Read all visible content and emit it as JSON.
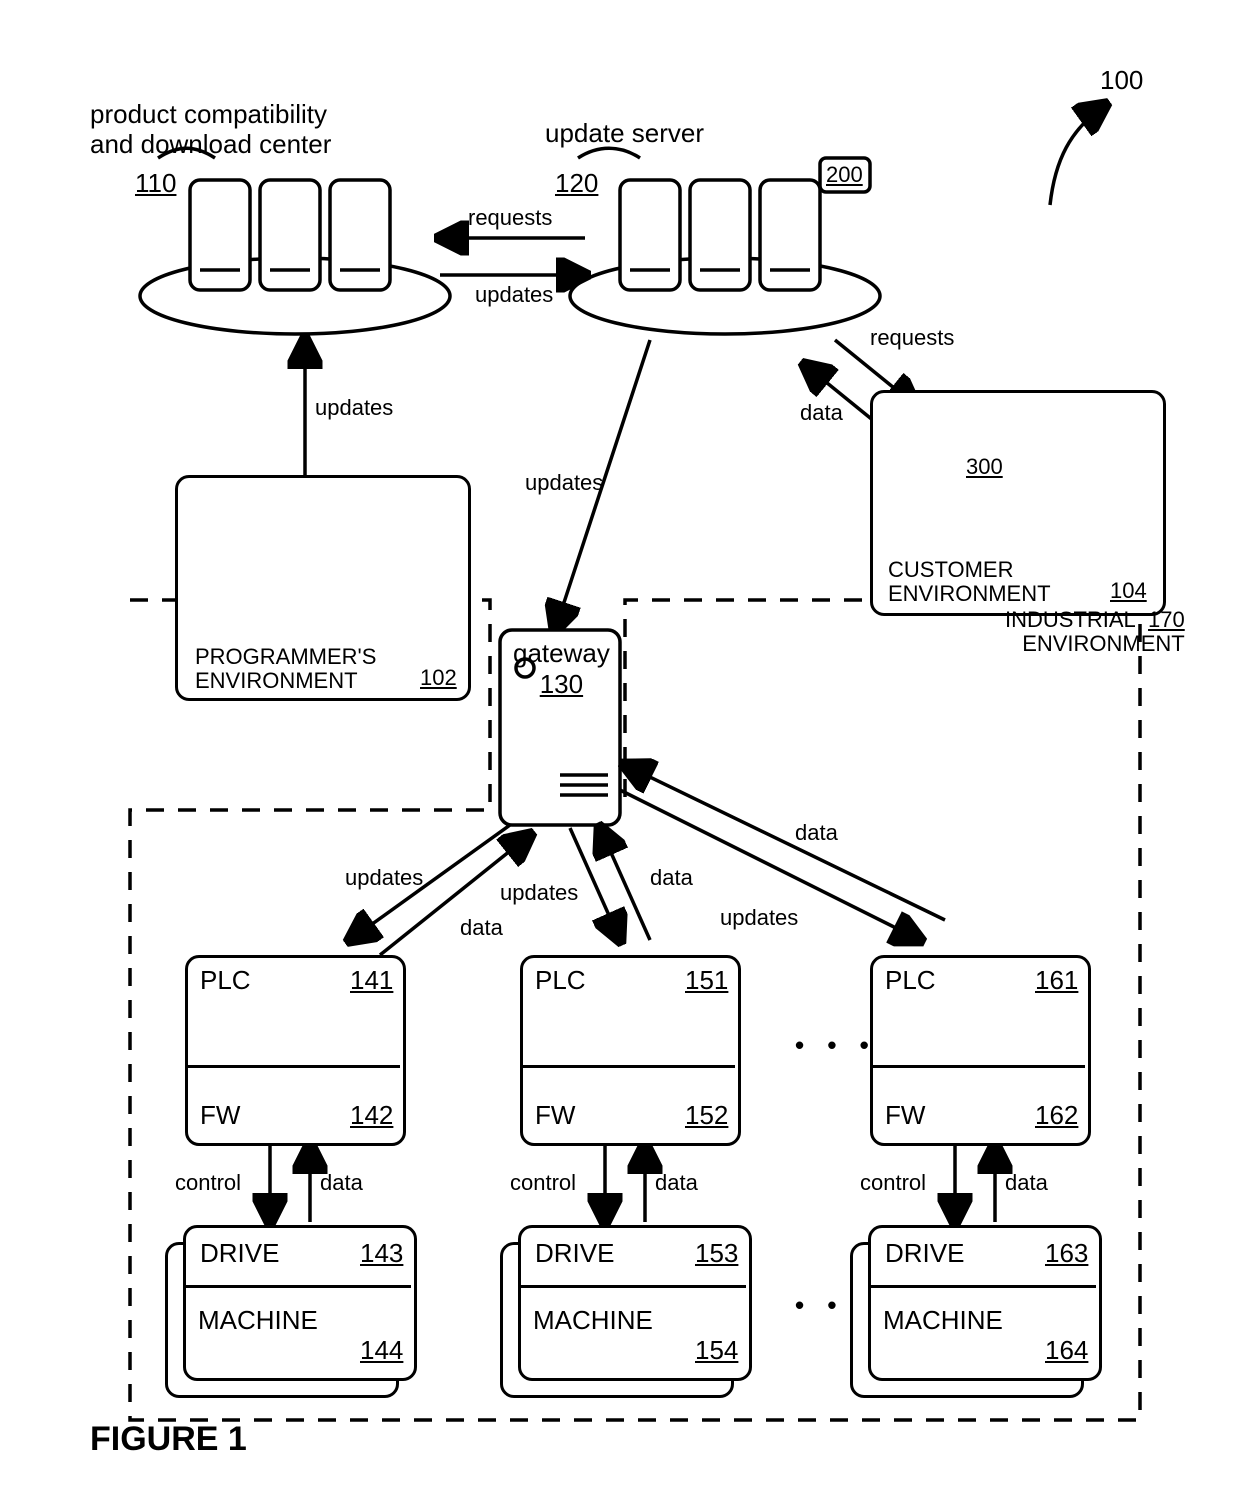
{
  "figure_label": "FIGURE 1",
  "system_ref": "100",
  "pcdc": {
    "label_line1": "product compatibility",
    "label_line2": "and download center",
    "ref": "110"
  },
  "update_server": {
    "label": "update server",
    "ref": "120"
  },
  "update_server_module": "200",
  "gateway": {
    "label": "gateway",
    "ref": "130"
  },
  "programmer_env": {
    "label_line1": "PROGRAMMER'S",
    "label_line2": "ENVIRONMENT",
    "ref": "102"
  },
  "customer_env": {
    "label_line1": "CUSTOMER",
    "label_line2": "ENVIRONMENT",
    "ref": "104",
    "module": "300"
  },
  "industrial_env": {
    "label_line1": "INDUSTRIAL",
    "label_line2": "ENVIRONMENT",
    "ref": "170"
  },
  "edge_labels": {
    "requests": "requests",
    "updates": "updates",
    "data": "data",
    "control": "control"
  },
  "ellipsis": "• • •",
  "plc_label": "PLC",
  "fw_label": "FW",
  "drive_label": "DRIVE",
  "machine_label": "MACHINE",
  "plc1": {
    "plc": "141",
    "fw": "142",
    "drive": "143",
    "machine": "144"
  },
  "plc2": {
    "plc": "151",
    "fw": "152",
    "drive": "153",
    "machine": "154"
  },
  "plc3": {
    "plc": "161",
    "fw": "162",
    "drive": "163",
    "machine": "164"
  }
}
